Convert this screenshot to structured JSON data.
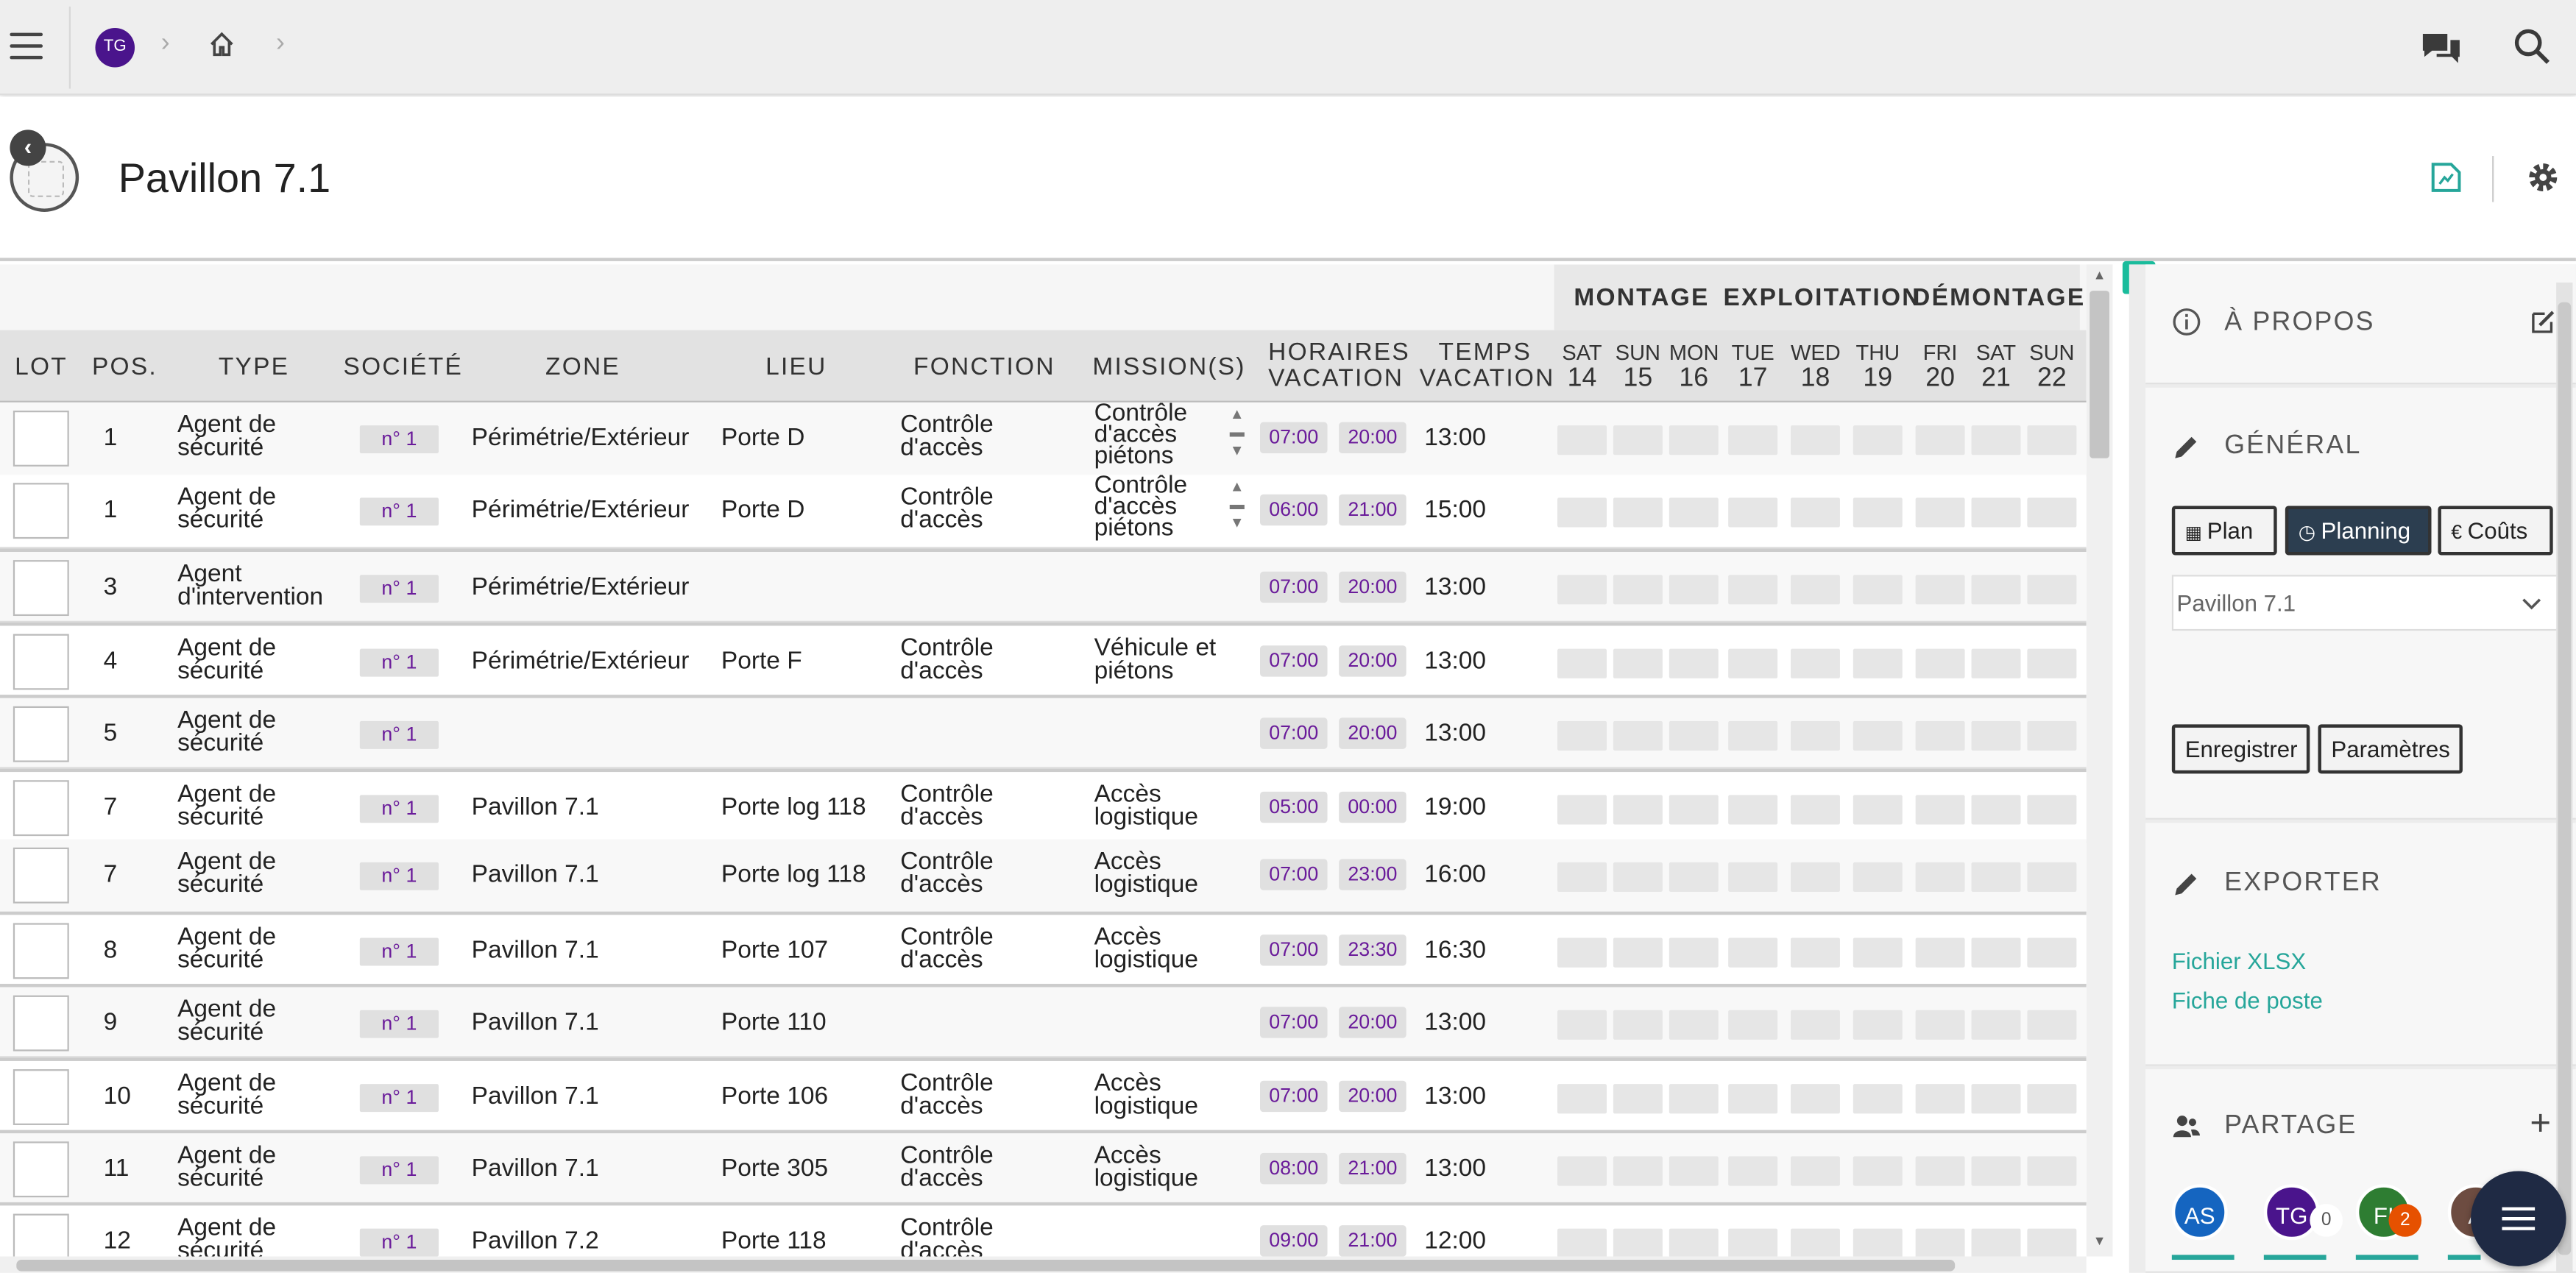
{
  "topbar": {
    "user_initials": "TG"
  },
  "page": {
    "title": "Pavillon 7.1"
  },
  "phases": [
    "MONTAGE",
    "EXPLOITATION",
    "DÉMONTAGE"
  ],
  "columns": {
    "lot": "LOT",
    "pos": "POS.",
    "type": "TYPE",
    "societe": "SOCIÉTÉ",
    "zone": "ZONE",
    "lieu": "LIEU",
    "fonction": "FONCTION",
    "missions": "MISSION(S)",
    "horaires": [
      "HORAIRES",
      "VACATION"
    ],
    "temps": [
      "TEMPS",
      "VACATION"
    ]
  },
  "days": [
    {
      "d": "SAT",
      "n": "14"
    },
    {
      "d": "SUN",
      "n": "15"
    },
    {
      "d": "MON",
      "n": "16"
    },
    {
      "d": "TUE",
      "n": "17"
    },
    {
      "d": "WED",
      "n": "18"
    },
    {
      "d": "THU",
      "n": "19"
    },
    {
      "d": "FRI",
      "n": "20"
    },
    {
      "d": "SAT",
      "n": "21"
    },
    {
      "d": "SUN",
      "n": "22"
    }
  ],
  "rows": [
    {
      "pos": "1",
      "type": [
        "Agent de",
        "sécurité"
      ],
      "societe": "n° 1",
      "zone": "Périmétrie/Extérieur",
      "lieu": "Porte D",
      "fonction": [
        "Contrôle",
        "d'accès"
      ],
      "mission": [
        "Contrôle",
        "d'accès",
        "piétons"
      ],
      "start": "07:00",
      "end": "20:00",
      "temps": "13:00"
    },
    {
      "pos": "1",
      "type": [
        "Agent de",
        "sécurité"
      ],
      "societe": "n° 1",
      "zone": "Périmétrie/Extérieur",
      "lieu": "Porte D",
      "fonction": [
        "Contrôle",
        "d'accès"
      ],
      "mission": [
        "Contrôle",
        "d'accès",
        "piétons"
      ],
      "start": "06:00",
      "end": "21:00",
      "temps": "15:00"
    },
    {
      "pos": "3",
      "type": [
        "Agent",
        "d'intervention"
      ],
      "societe": "n° 1",
      "zone": "Périmétrie/Extérieur",
      "lieu": "",
      "fonction": [
        "",
        ""
      ],
      "mission": [
        "",
        ""
      ],
      "start": "07:00",
      "end": "20:00",
      "temps": "13:00"
    },
    {
      "pos": "4",
      "type": [
        "Agent de",
        "sécurité"
      ],
      "societe": "n° 1",
      "zone": "Périmétrie/Extérieur",
      "lieu": "Porte F",
      "fonction": [
        "Contrôle",
        "d'accès"
      ],
      "mission": [
        "Véhicule et",
        "piétons"
      ],
      "start": "07:00",
      "end": "20:00",
      "temps": "13:00"
    },
    {
      "pos": "5",
      "type": [
        "Agent de",
        "sécurité"
      ],
      "societe": "n° 1",
      "zone": "",
      "lieu": "",
      "fonction": [
        "",
        ""
      ],
      "mission": [
        "",
        ""
      ],
      "start": "07:00",
      "end": "20:00",
      "temps": "13:00"
    },
    {
      "pos": "7",
      "type": [
        "Agent de",
        "sécurité"
      ],
      "societe": "n° 1",
      "zone": "Pavillon 7.1",
      "lieu": "Porte log 118",
      "fonction": [
        "Contrôle",
        "d'accès"
      ],
      "mission": [
        "Accès",
        "logistique"
      ],
      "start": "05:00",
      "end": "00:00",
      "temps": "19:00"
    },
    {
      "pos": "7",
      "type": [
        "Agent de",
        "sécurité"
      ],
      "societe": "n° 1",
      "zone": "Pavillon 7.1",
      "lieu": "Porte log 118",
      "fonction": [
        "Contrôle",
        "d'accès"
      ],
      "mission": [
        "Accès",
        "logistique"
      ],
      "start": "07:00",
      "end": "23:00",
      "temps": "16:00"
    },
    {
      "pos": "8",
      "type": [
        "Agent de",
        "sécurité"
      ],
      "societe": "n° 1",
      "zone": "Pavillon 7.1",
      "lieu": "Porte 107",
      "fonction": [
        "Contrôle",
        "d'accès"
      ],
      "mission": [
        "Accès",
        "logistique"
      ],
      "start": "07:00",
      "end": "23:30",
      "temps": "16:30"
    },
    {
      "pos": "9",
      "type": [
        "Agent de",
        "sécurité"
      ],
      "societe": "n° 1",
      "zone": "Pavillon 7.1",
      "lieu": "Porte 110",
      "fonction": [
        "",
        ""
      ],
      "mission": [
        "",
        ""
      ],
      "start": "07:00",
      "end": "20:00",
      "temps": "13:00"
    },
    {
      "pos": "10",
      "type": [
        "Agent de",
        "sécurité"
      ],
      "societe": "n° 1",
      "zone": "Pavillon 7.1",
      "lieu": "Porte 106",
      "fonction": [
        "Contrôle",
        "d'accès"
      ],
      "mission": [
        "Accès",
        "logistique"
      ],
      "start": "07:00",
      "end": "20:00",
      "temps": "13:00"
    },
    {
      "pos": "11",
      "type": [
        "Agent de",
        "sécurité"
      ],
      "societe": "n° 1",
      "zone": "Pavillon 7.1",
      "lieu": "Porte 305",
      "fonction": [
        "Contrôle",
        "d'accès"
      ],
      "mission": [
        "Accès",
        "logistique"
      ],
      "start": "08:00",
      "end": "21:00",
      "temps": "13:00"
    },
    {
      "pos": "12",
      "type": [
        "Agent de",
        "sécurité"
      ],
      "societe": "n° 1",
      "zone": "Pavillon 7.2",
      "lieu": "Porte 118",
      "fonction": [
        "Contrôle",
        "d'accès"
      ],
      "mission": [
        "",
        ""
      ],
      "start": "09:00",
      "end": "21:00",
      "temps": "12:00"
    }
  ],
  "sidebar": {
    "about": "À PROPOS",
    "general": "GÉNÉRAL",
    "buttons": {
      "plan": "Plan",
      "planning": "Planning",
      "couts": "Coûts"
    },
    "select_value": "Pavillon 7.1",
    "save": "Enregistrer",
    "params": "Paramètres",
    "export": "EXPORTER",
    "links": [
      "Fichier XLSX",
      "Fiche de poste"
    ],
    "share": "PARTAGE",
    "avatars": [
      {
        "initials": "AS",
        "color": "#1565c0"
      },
      {
        "initials": "TG",
        "color": "#4a148c"
      },
      {
        "initials": "FI",
        "color": "#2e7d32"
      },
      {
        "initials": "A",
        "color": "#6d4c41"
      }
    ],
    "badges": [
      "0",
      "2"
    ]
  },
  "colors": {
    "accent": "#26a69a",
    "brand": "#4a148c",
    "active_button": "#2c3e50",
    "tag_text": "#6a1b9a"
  }
}
